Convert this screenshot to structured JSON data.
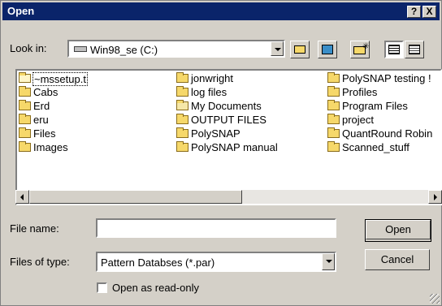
{
  "window": {
    "title": "Open"
  },
  "titlebar_buttons": {
    "help": "?",
    "close": "X"
  },
  "lookin": {
    "label": "Look in:",
    "value": "Win98_se (C:)",
    "icon": "drive-icon"
  },
  "toolbar": [
    "up-folder-icon",
    "desktop-icon",
    "new-folder-icon",
    "list-view-icon",
    "details-view-icon"
  ],
  "files": {
    "col1": [
      "~mssetup.t",
      "Cabs",
      "Erd",
      "eru",
      "Files",
      "Images"
    ],
    "col2": [
      "jonwright",
      "log files",
      "My Documents",
      "OUTPUT FILES",
      "PolySNAP",
      "PolySNAP manual"
    ],
    "col3": [
      "PolySNAP testing !",
      "Profiles",
      "Program Files",
      "project",
      "QuantRound Robin",
      "Scanned_stuff"
    ]
  },
  "filename": {
    "label": "File name:",
    "value": ""
  },
  "filetype": {
    "label": "Files of type:",
    "value": "Pattern Databses (*.par)"
  },
  "buttons": {
    "open": "Open",
    "cancel": "Cancel"
  },
  "readonly": {
    "label": "Open as read-only",
    "checked": false
  }
}
